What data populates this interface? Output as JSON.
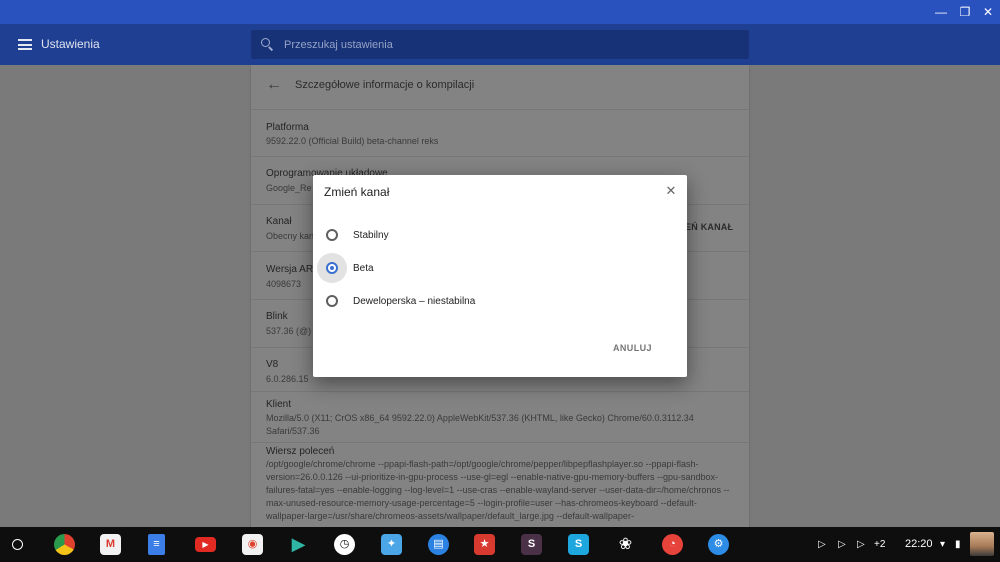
{
  "window": {
    "minimize_icon": "minimize-icon",
    "maximize_icon": "maximize-icon",
    "close_icon": "close-icon"
  },
  "appbar": {
    "title": "Ustawienia",
    "search_placeholder": "Przeszukaj ustawienia"
  },
  "card": {
    "heading": "Szczegółowe informacje o kompilacji",
    "rows": [
      {
        "label": "Platforma",
        "value": "9592.22.0 (Official Build) beta-channel reks"
      },
      {
        "label": "Oprogramowanie układowe",
        "value": "Google_Re"
      },
      {
        "label": "Kanał",
        "value": "Obecny kan",
        "action": "ZMIEŃ KANAŁ"
      },
      {
        "label": "Wersja ARC",
        "value": "4098673"
      },
      {
        "label": "Blink",
        "value": "537.36 (@)"
      },
      {
        "label": "V8",
        "value": "6.0.286.15"
      },
      {
        "label": "Klient",
        "value": "Mozilla/5.0 (X11; CrOS x86_64 9592.22.0) AppleWebKit/537.36 (KHTML, like Gecko) Chrome/60.0.3112.34 Safari/537.36"
      },
      {
        "label": "Wiersz poleceń",
        "value": "/opt/google/chrome/chrome --ppapi-flash-path=/opt/google/chrome/pepper/libpepflashplayer.so --ppapi-flash-version=26.0.0.126 --ui-prioritize-in-gpu-process --use-gl=egl --enable-native-gpu-memory-buffers --gpu-sandbox-failures-fatal=yes --enable-logging --log-level=1 --use-cras --enable-wayland-server --user-data-dir=/home/chronos --max-unused-resource-memory-usage-percentage=5 --login-profile=user --has-chromeos-keyboard --default-wallpaper-large=/usr/share/chromeos-assets/wallpaper/default_large.jpg --default-wallpaper-"
      }
    ]
  },
  "dialog": {
    "title": "Zmień kanał",
    "options": [
      {
        "label": "Stabilny",
        "checked": false
      },
      {
        "label": "Beta",
        "checked": true
      },
      {
        "label": "Deweloperska – niestabilna",
        "checked": false
      }
    ],
    "cancel_label": "ANULUJ"
  },
  "shelf": {
    "apps": [
      {
        "name": "chrome",
        "color": "#e0412f"
      },
      {
        "name": "gmail",
        "color": "#d93b30"
      },
      {
        "name": "docs",
        "color": "#3c7ee8"
      },
      {
        "name": "youtube",
        "color": "#e02a22"
      },
      {
        "name": "chrome-web-store",
        "color": "#f2f2f2"
      },
      {
        "name": "play-store",
        "color": "#2fb5a4"
      },
      {
        "name": "clock",
        "color": "#ffffff"
      },
      {
        "name": "twitter",
        "color": "#4aa6e6"
      },
      {
        "name": "files",
        "color": "#2b82e2"
      },
      {
        "name": "wunderlist",
        "color": "#d93a2f"
      },
      {
        "name": "slack",
        "color": "#4a3148"
      },
      {
        "name": "skype",
        "color": "#1ea6df"
      },
      {
        "name": "lotus",
        "color": "#1b1b1b"
      },
      {
        "name": "pocketcasts",
        "color": "#e6433a"
      },
      {
        "name": "settings",
        "color": "#2c8ce6"
      }
    ],
    "notification_count": "+2",
    "time": "22:20"
  }
}
